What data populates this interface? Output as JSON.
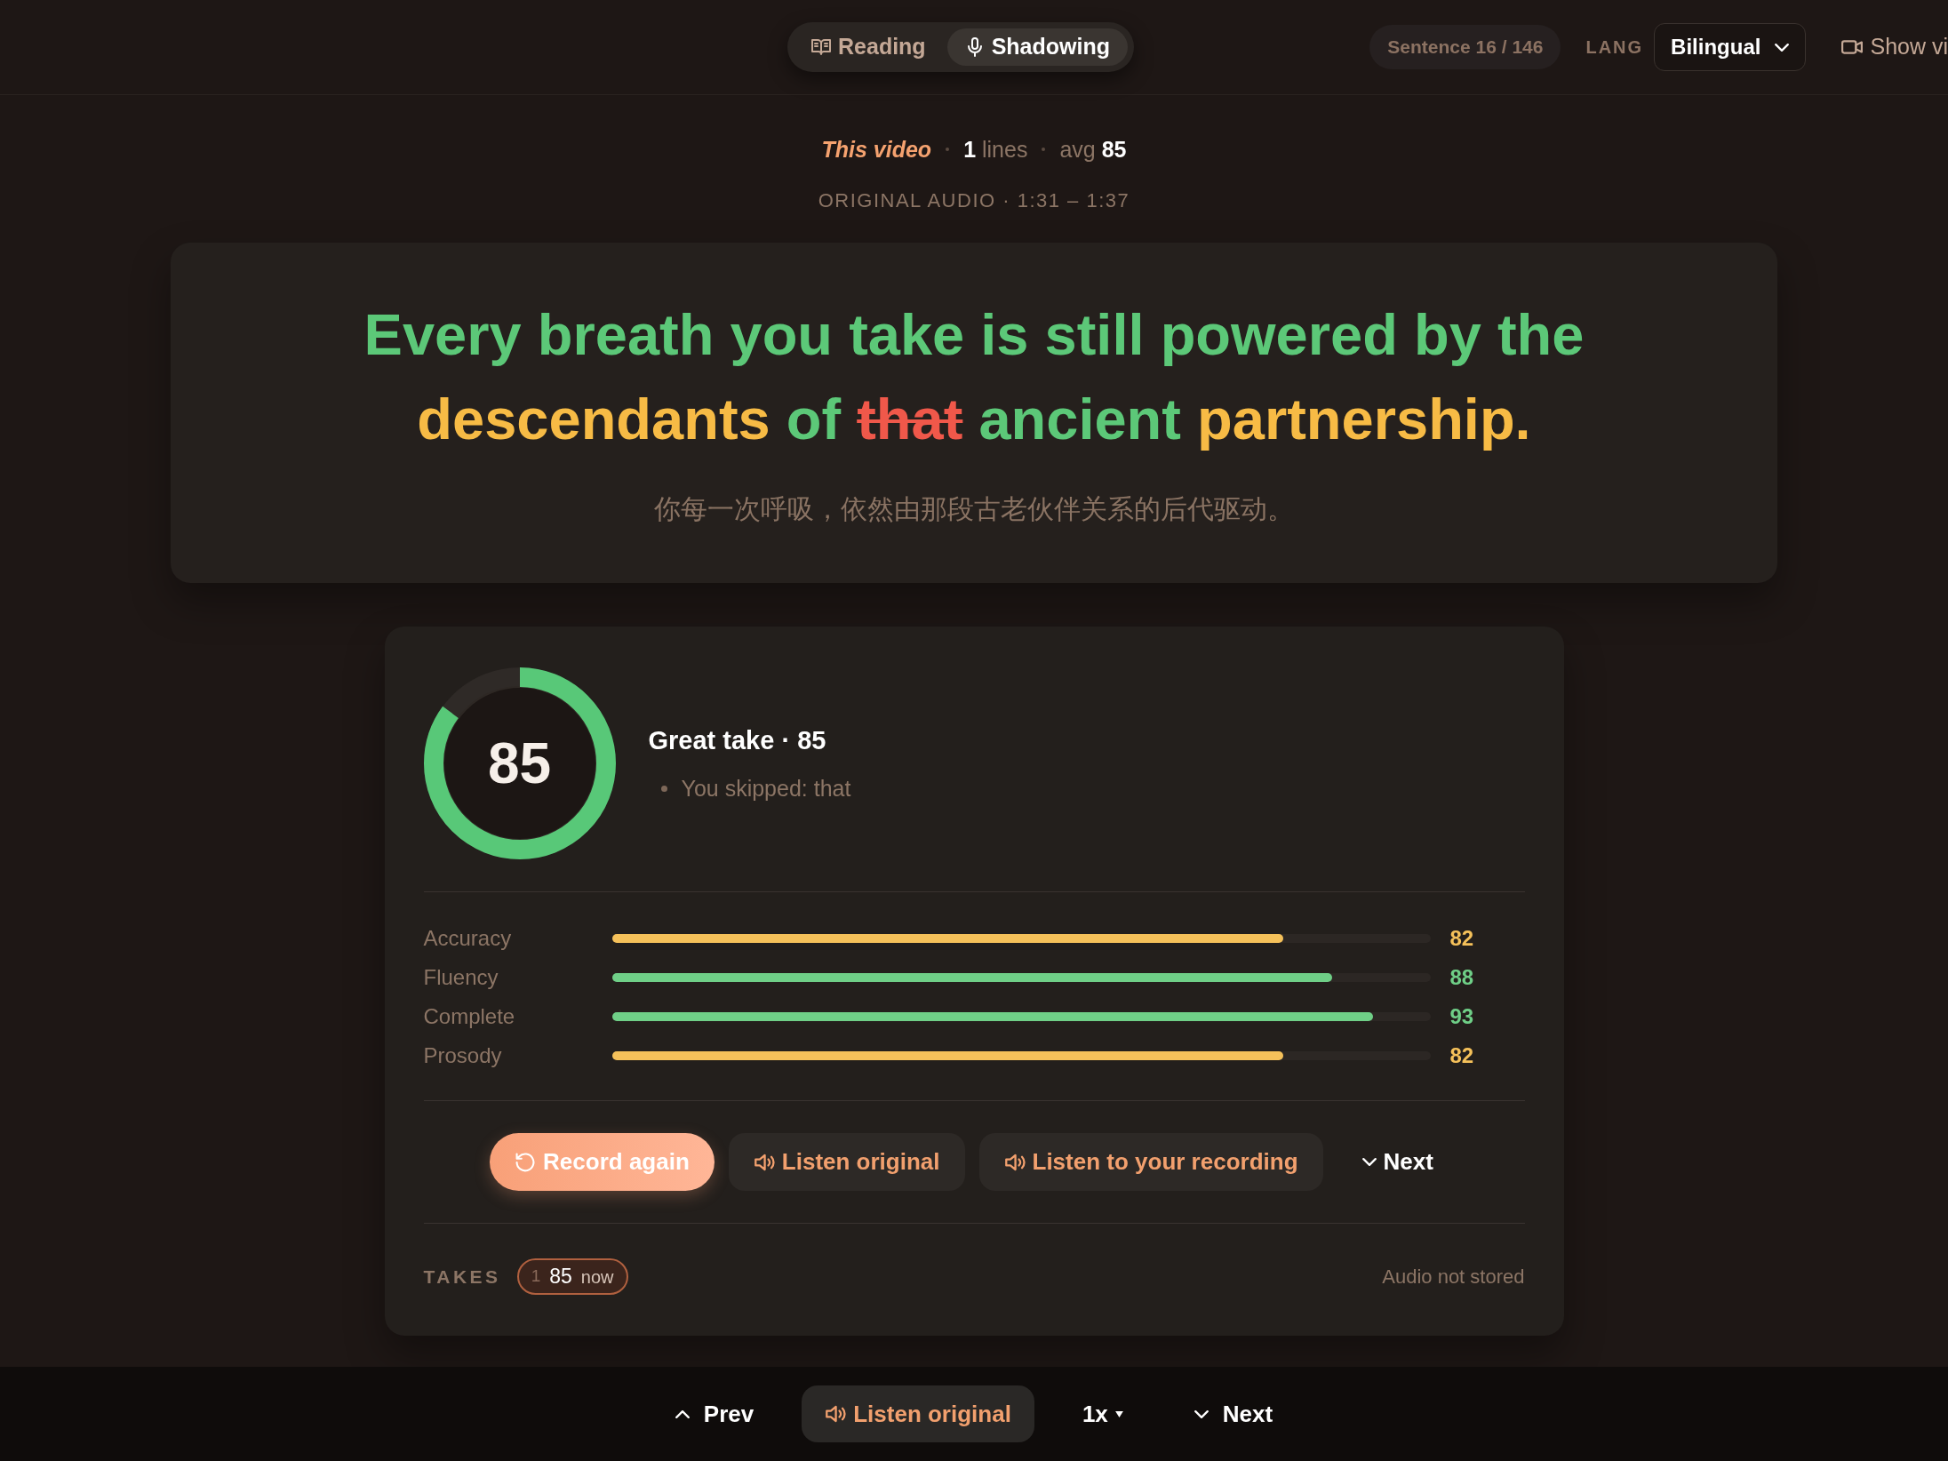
{
  "topbar": {
    "modes": [
      {
        "label": "Reading",
        "kind": "reading",
        "selected": false
      },
      {
        "label": "Shadowing",
        "kind": "shadowing",
        "selected": true
      }
    ],
    "sentence_counter": "Sentence 16 / 146",
    "lang_label": "LANG",
    "lang_select": {
      "value": "Bilingual"
    },
    "show_video": "Show vi"
  },
  "summary": {
    "source": "This video",
    "lines": "**1** lines",
    "average": "avg **85**"
  },
  "audio_range": "ORIGINAL AUDIO · 1:31 – 1:37",
  "sentence": {
    "words": [
      {
        "text": "Every",
        "kind": "good"
      },
      {
        "text": "breath",
        "kind": "good"
      },
      {
        "text": "you",
        "kind": "good"
      },
      {
        "text": "take",
        "kind": "good"
      },
      {
        "text": "is",
        "kind": "good"
      },
      {
        "text": "still",
        "kind": "good"
      },
      {
        "text": "powered",
        "kind": "good"
      },
      {
        "text": "by",
        "kind": "good"
      },
      {
        "text": "the",
        "kind": "good"
      },
      {
        "text": "descendants",
        "kind": "fair"
      },
      {
        "text": "of",
        "kind": "good"
      },
      {
        "text": "that",
        "kind": "skipped"
      },
      {
        "text": "ancient",
        "kind": "good"
      },
      {
        "text": "partnership.",
        "kind": "fair"
      }
    ],
    "translation": "你每一次呼吸，依然由那段古老伙伴关系的后代驱动。"
  },
  "result": {
    "score": "85",
    "level": 0.85,
    "headline": "Great take · 85",
    "notes": [
      "You skipped: that"
    ],
    "metrics": [
      {
        "label": "Accuracy",
        "level": 0.82,
        "value": "82",
        "color": "#f5c15a"
      },
      {
        "label": "Fluency",
        "level": 0.88,
        "value": "88",
        "color": "#6fcf87"
      },
      {
        "label": "Complete",
        "level": 0.93,
        "value": "93",
        "color": "#6fcf87"
      },
      {
        "label": "Prosody",
        "level": 0.82,
        "value": "82",
        "color": "#f5c15a"
      }
    ],
    "actions": [
      {
        "label": "Record again",
        "kind": "primary"
      },
      {
        "label": "Listen original",
        "kind": "audio"
      },
      {
        "label": "Listen to your recording",
        "kind": "audio"
      },
      {
        "label": "Next",
        "kind": "next"
      }
    ],
    "takes_label": "TAKES",
    "takes": [
      {
        "index": "1",
        "score": "85",
        "time": "now",
        "selected": true
      }
    ],
    "storage_note": "Audio not stored"
  },
  "bottom_bar": {
    "items": [
      {
        "label": "Prev",
        "kind": "prev"
      },
      {
        "label": "Listen original",
        "kind": "audio"
      },
      {
        "label": "1x",
        "kind": "speed"
      },
      {
        "label": "Next",
        "kind": "next"
      }
    ]
  }
}
